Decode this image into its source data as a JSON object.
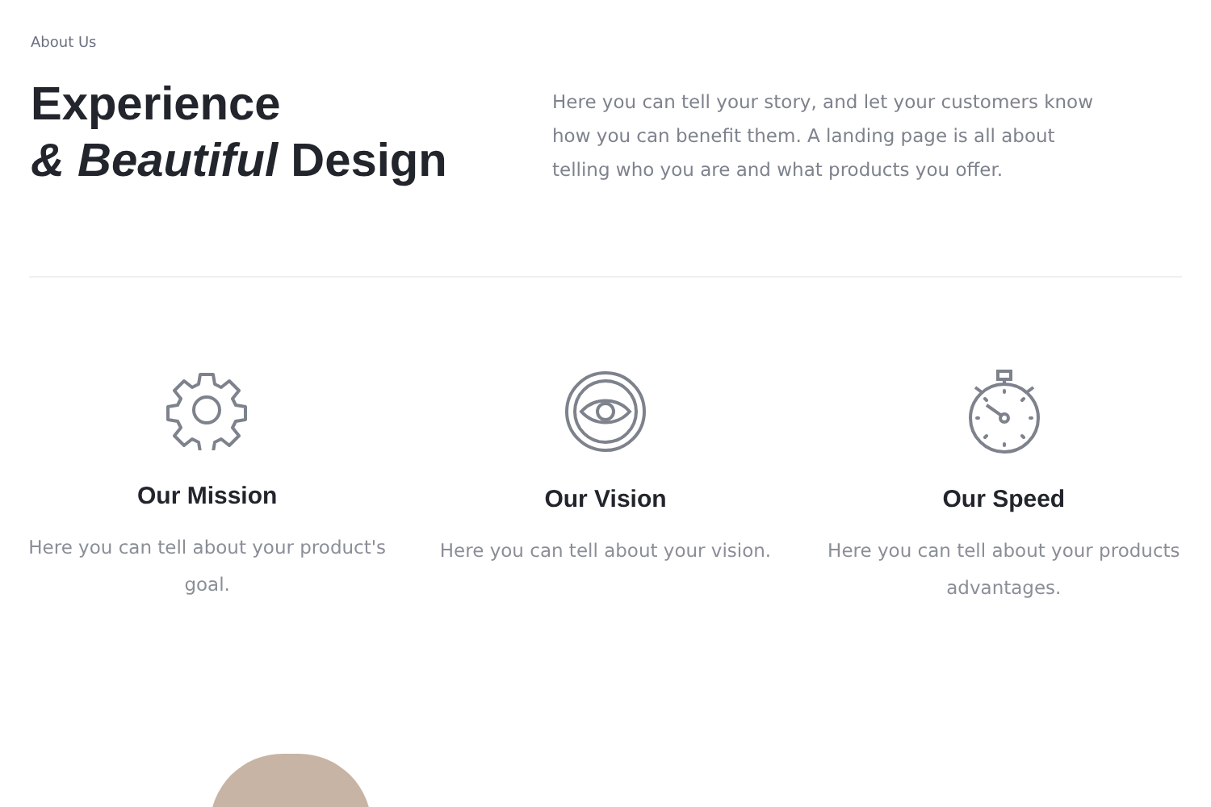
{
  "section_label": "About Us",
  "heading": {
    "line_1": "Experience",
    "line_2": "*& Beautiful* Design"
  },
  "intro": "Here you can tell your story, and let your customers know how you can benefit them. A landing page is all about telling who you are and what products you offer.",
  "features": [
    {
      "kind": "gear",
      "title": "Our Mission",
      "text": "Here you can tell about your product's goal."
    },
    {
      "kind": "eye",
      "title": "Our Vision",
      "text": "Here you can tell about your vision."
    },
    {
      "kind": "stopwatch",
      "title": "Our Speed",
      "text": "Here you can tell about your products advantages."
    }
  ]
}
